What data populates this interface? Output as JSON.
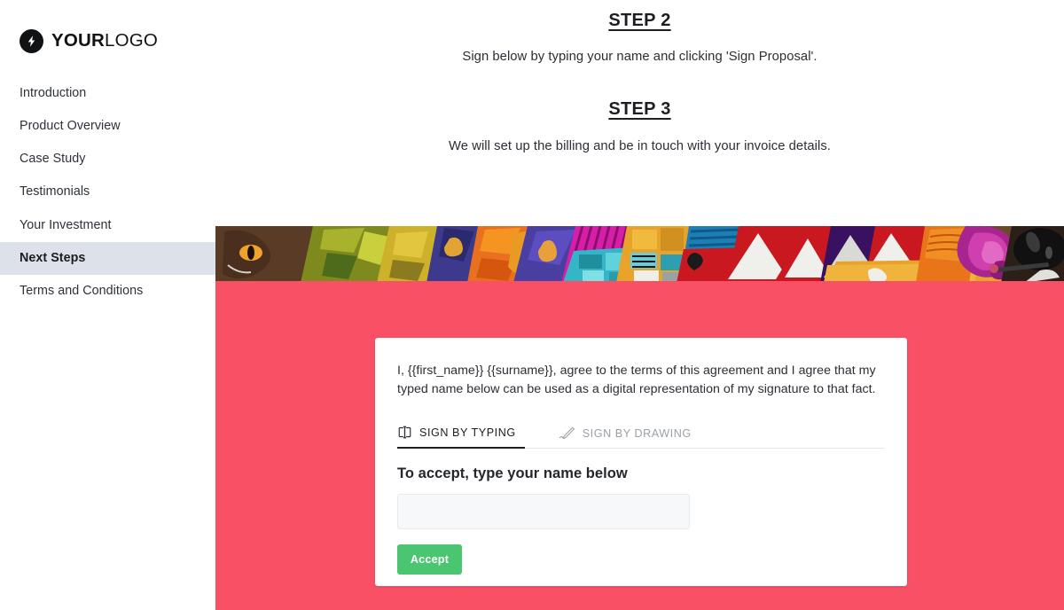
{
  "brand": {
    "logo_bold": "YOUR",
    "logo_light": "LOGO",
    "logo_icon": "lightning-bolt-icon",
    "logo_bg": "#111214"
  },
  "sidebar": {
    "items": [
      {
        "label": "Introduction",
        "active": false
      },
      {
        "label": "Product Overview",
        "active": false
      },
      {
        "label": "Case Study",
        "active": false
      },
      {
        "label": "Testimonials",
        "active": false
      },
      {
        "label": "Your Investment",
        "active": false
      },
      {
        "label": "Next Steps",
        "active": true
      },
      {
        "label": "Terms and Conditions",
        "active": false
      }
    ],
    "active_bg": "#dde1e9"
  },
  "document": {
    "step2_heading": "STEP 2",
    "step2_body": "Sign below by typing your name and clicking 'Sign Proposal'.",
    "step3_heading": "STEP 3",
    "step3_body": "We will set up the billing and be in touch with your invoice details."
  },
  "banner": {
    "alt": "Colorful graffiti street art mural",
    "accent": "#fa5066"
  },
  "section": {
    "background": "#fa5066"
  },
  "sign_card": {
    "agreement_text": "I, {{first_name}} {{surname}}, agree to the terms of this agreement and I agree that my typed name below can be used as a digital representation of my signature to that fact.",
    "tabs": [
      {
        "label": "SIGN BY TYPING",
        "icon": "type-cursor-icon",
        "active": true
      },
      {
        "label": "SIGN BY DRAWING",
        "icon": "pen-signature-icon",
        "active": false
      }
    ],
    "input_label": "To accept, type your name below",
    "input_value": "",
    "input_placeholder": "",
    "accept_label": "Accept",
    "accept_color": "#4bc56f"
  }
}
